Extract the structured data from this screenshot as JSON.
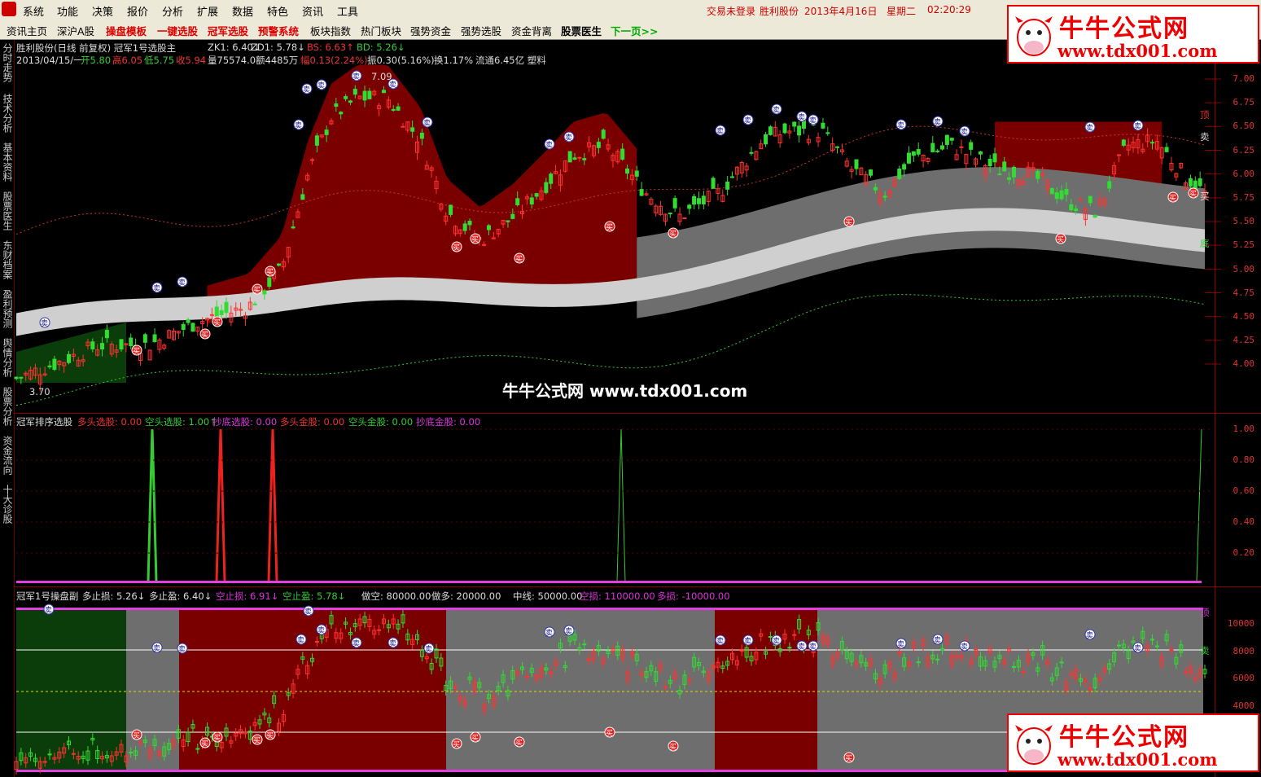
{
  "menu": {
    "items": [
      "系统",
      "功能",
      "决策",
      "报价",
      "分析",
      "扩展",
      "数据",
      "特色",
      "资讯",
      "工具"
    ],
    "status_login": "交易未登录",
    "stock_name": "胜利股份",
    "date": "2013年4月16日",
    "weekday": "星期二",
    "time": "02:20:29"
  },
  "toolbar": {
    "items": [
      {
        "label": "资讯主页",
        "style": "normal"
      },
      {
        "label": "深沪A股",
        "style": "normal"
      },
      {
        "label": "操盘模板",
        "style": "red"
      },
      {
        "label": "一键选股",
        "style": "red"
      },
      {
        "label": "冠军选股",
        "style": "red"
      },
      {
        "label": "预警系统",
        "style": "red"
      },
      {
        "label": "板块指数",
        "style": "normal"
      },
      {
        "label": "热门板块",
        "style": "normal"
      },
      {
        "label": "强势资金",
        "style": "normal"
      },
      {
        "label": "强势选股",
        "style": "normal"
      },
      {
        "label": "资金背离",
        "style": "normal"
      },
      {
        "label": "股票医生",
        "style": "bold"
      },
      {
        "label": "下一页>>",
        "style": "green"
      }
    ]
  },
  "sidebar": {
    "tabs": [
      "分时走势",
      "技术分析",
      "基本资料",
      "股票医生",
      "东财档案",
      "盈利预测",
      "舆情分析",
      "股票分析",
      "资金流向",
      "十大诊股"
    ]
  },
  "main_panel": {
    "title": "胜利股份(日线 前复权) 冠军1号选股主",
    "zk1": "ZK1: 6.40↓",
    "zd1": "ZD1: 5.78↓",
    "bs": "BS: 6.63↑",
    "bd": "BD: 5.26↓",
    "bar_info_date": "2013/04/15/一",
    "bar_info_open": "开5.80",
    "bar_info_high": "高6.05",
    "bar_info_low": "低5.75",
    "bar_info_close": "收5.94",
    "bar_info_vol": "量75574.0",
    "bar_info_amt": "额4485万",
    "bar_info_range": "幅0.13(2.24%)",
    "bar_info_amp": "振0.30(5.16%)",
    "bar_info_turn": "换1.17%",
    "bar_info_float": "流通6.45亿 塑料",
    "high_mark": "7.09",
    "low_mark": "3.70",
    "y_ticks": [
      "7.00",
      "6.75",
      "6.50",
      "6.25",
      "6.00",
      "5.75",
      "5.50",
      "5.25",
      "5.00",
      "4.75",
      "4.50",
      "4.25",
      "4.00"
    ],
    "band_labels": {
      "top": "顶",
      "sell": "卖",
      "buy": "买",
      "bottom": "底"
    },
    "center_watermark": "牛牛公式网 www.tdx001.com"
  },
  "rank_panel": {
    "title": "冠军排序选股",
    "items": [
      {
        "label": "多头选股: 0.00",
        "color": "#e33"
      },
      {
        "label": "空头选股: 1.00↑",
        "color": "#3c3"
      },
      {
        "label": "抄底选股: 0.00",
        "color": "#d3d"
      },
      {
        "label": "多头金股: 0.00",
        "color": "#e33"
      },
      {
        "label": "空头金股: 0.00",
        "color": "#3c3"
      },
      {
        "label": "抄底金股: 0.00",
        "color": "#d3d"
      }
    ],
    "y_ticks": [
      "1.00",
      "0.80",
      "0.60",
      "0.40",
      "0.20"
    ]
  },
  "sub_panel": {
    "title": "冠军1号操盘副",
    "items": [
      {
        "label": "多止损: 5.26↓",
        "color": "#ddd"
      },
      {
        "label": "多止盈: 6.40↓",
        "color": "#ddd"
      },
      {
        "label": "空止损: 6.91↓",
        "color": "#d3d"
      },
      {
        "label": "空止盈: 5.78↓",
        "color": "#3c3"
      },
      {
        "label": "做空: 80000.00",
        "color": "#ddd"
      },
      {
        "label": "做多: 20000.00",
        "color": "#ddd"
      },
      {
        "label": "中线: 50000.00",
        "color": "#ddd"
      },
      {
        "label": "空损: 110000.00",
        "color": "#d3d"
      },
      {
        "label": "多损: -10000.00",
        "color": "#d3d"
      }
    ],
    "y_ticks": [
      "10000",
      "8000",
      "6000",
      "4000"
    ],
    "band_labels": {
      "top": "顶",
      "sell": "卖"
    }
  },
  "watermark": {
    "title": "牛牛公式网",
    "url": "www.tdx001.com"
  },
  "signals": {
    "buy": "买",
    "sell": "卖"
  },
  "colors": {
    "up": "#ff3232",
    "down": "#32dc32",
    "band_dark": "#7a0000",
    "band_gray": "#6e6e6e",
    "band_light": "#cfcfcf",
    "magenta": "#e040e0"
  }
}
